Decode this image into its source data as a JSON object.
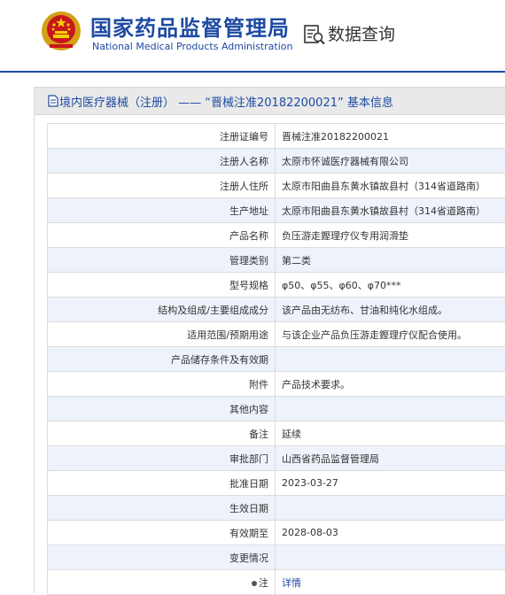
{
  "header": {
    "brand_cn": "国家药品监督管理局",
    "brand_en": "National Medical Products Administration",
    "query_title": "数据查询",
    "brand_color": "#1d4aa3"
  },
  "panel": {
    "title": "境内医疗器械（注册） —— “晋械注准20182200021” 基本信息"
  },
  "rows": [
    {
      "label": "注册证编号",
      "value": "晋械注准20182200021"
    },
    {
      "label": "注册人名称",
      "value": "太原市怀诚医疗器械有限公司"
    },
    {
      "label": "注册人住所",
      "value": "太原市阳曲县东黄水镇故县村（314省道路南）"
    },
    {
      "label": "生产地址",
      "value": "太原市阳曲县东黄水镇故县村（314省道路南）"
    },
    {
      "label": "产品名称",
      "value": "负压游走鏗理疗仪专用润滑垫"
    },
    {
      "label": "管理类别",
      "value": "第二类"
    },
    {
      "label": "型号规格",
      "value": "φ50、φ55、φ60、φ70***"
    },
    {
      "label": "结构及组成/主要组成成分",
      "value": "该产品由无纺布、甘油和纯化水组成。"
    },
    {
      "label": "适用范围/预期用途",
      "value": "与该企业产品负压游走鏗理疗仪配合使用。"
    },
    {
      "label": "产品储存条件及有效期",
      "value": ""
    },
    {
      "label": "附件",
      "value": "产品技术要求。"
    },
    {
      "label": "其他内容",
      "value": ""
    },
    {
      "label": "备注",
      "value": "延续"
    },
    {
      "label": "审批部门",
      "value": "山西省药品监督管理局"
    },
    {
      "label": "批准日期",
      "value": "2023-03-27"
    },
    {
      "label": "生效日期",
      "value": ""
    },
    {
      "label": "有效期至",
      "value": "2028-08-03"
    },
    {
      "label": "变更情况",
      "value": ""
    },
    {
      "label": "注",
      "value": "详情"
    }
  ]
}
